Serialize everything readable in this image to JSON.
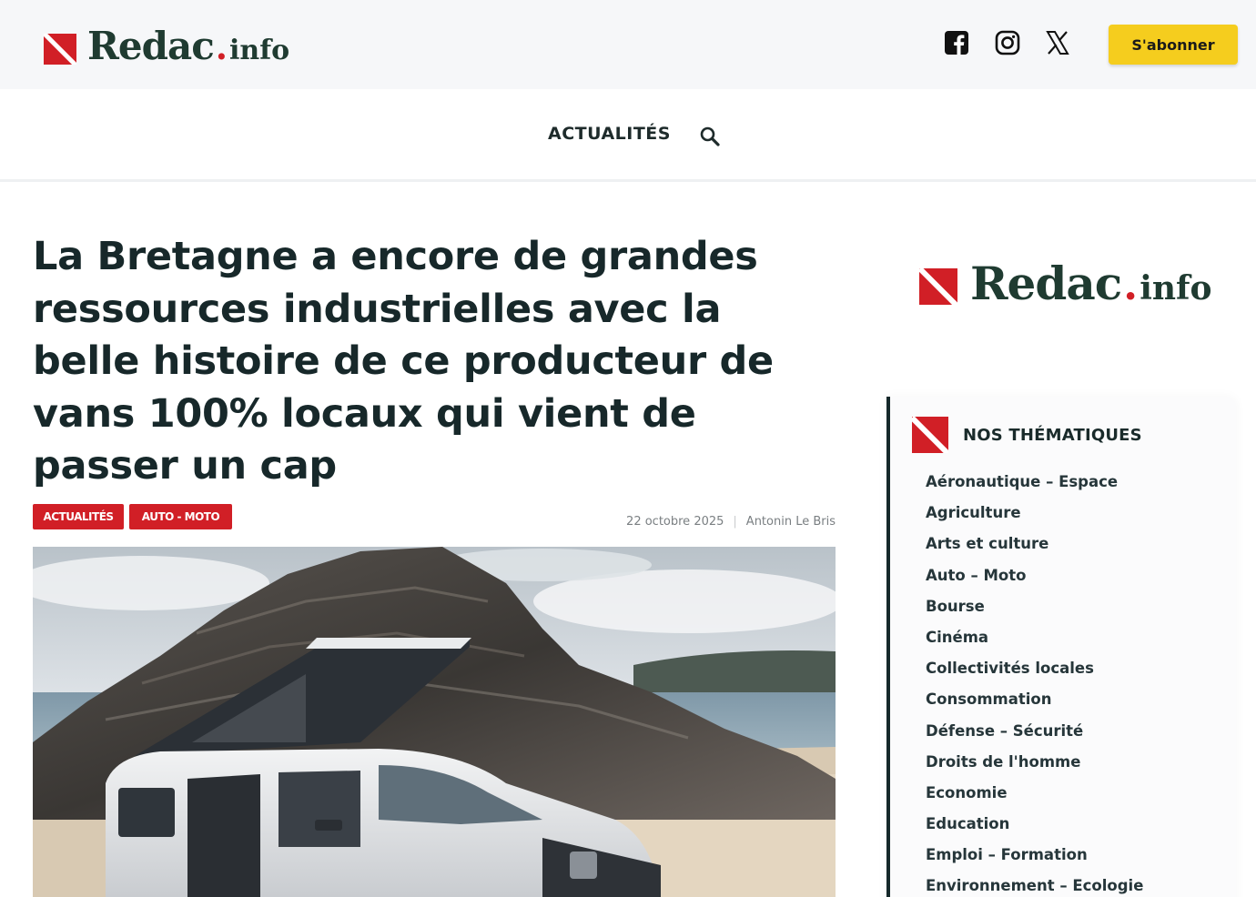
{
  "header": {
    "logo": {
      "word": "Redac",
      "dot": ".",
      "tld": "info"
    },
    "social": [
      "facebook-icon",
      "instagram-icon",
      "x-icon"
    ],
    "subscribe_label": "S'abonner"
  },
  "nav": {
    "items": [
      {
        "label": "ACTUALITÉS"
      }
    ],
    "search_icon": "search-icon"
  },
  "article": {
    "title": "La Bretagne a encore de grandes ressources industrielles avec la belle histoire de ce producteur de vans 100% locaux qui vient de passer un cap",
    "tags": [
      "Actualités",
      "Auto - Moto"
    ],
    "date": "22 octobre 2025",
    "separator": "|",
    "author": "Antonin Le Bris"
  },
  "sidebar": {
    "logo": {
      "word": "Redac",
      "dot": ".",
      "tld": "info"
    },
    "themes_title": "NOS THÉMATIQUES",
    "themes": [
      "Aéronautique – Espace",
      "Agriculture",
      "Arts et culture",
      "Auto – Moto",
      "Bourse",
      "Cinéma",
      "Collectivités locales",
      "Consommation",
      "Défense – Sécurité",
      "Droits de l'homme",
      "Economie",
      "Education",
      "Emploi – Formation",
      "Environnement – Ecologie"
    ]
  },
  "colors": {
    "brand_red": "#d11f26",
    "brand_green": "#1f3b31",
    "subscribe_yellow": "#f5cd1e",
    "text_dark": "#17282a"
  }
}
